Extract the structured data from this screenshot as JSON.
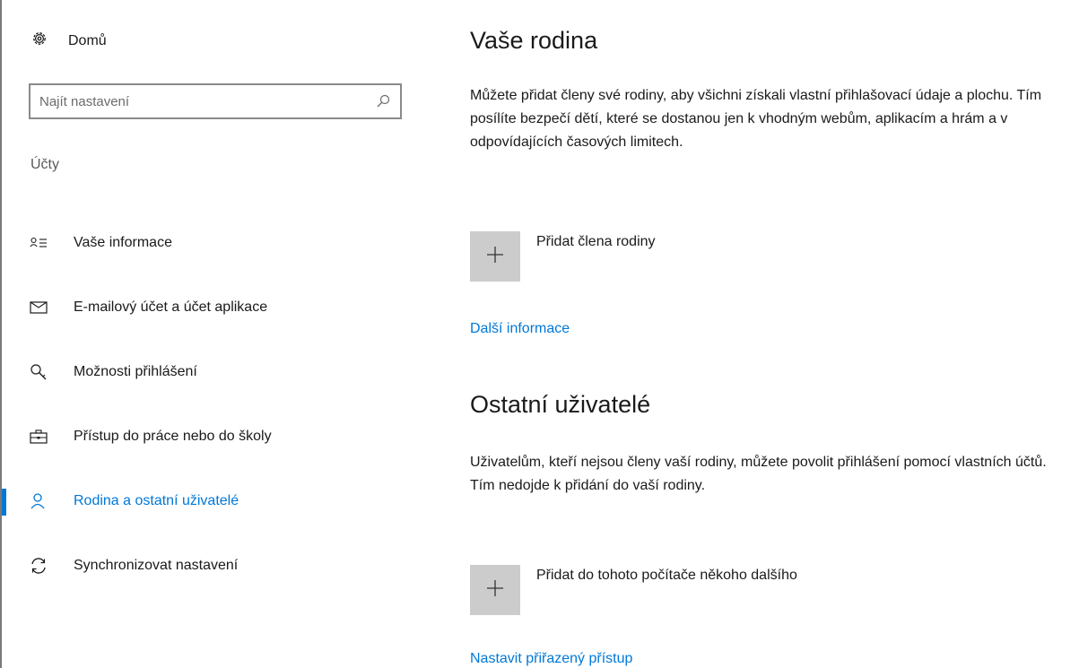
{
  "sidebar": {
    "home_label": "Domů",
    "search_placeholder": "Najít nastavení",
    "section_label": "Účty",
    "items": [
      {
        "label": "Vaše informace",
        "icon": "person-card-icon"
      },
      {
        "label": "E-mailový účet a účet aplikace",
        "icon": "mail-icon"
      },
      {
        "label": "Možnosti přihlášení",
        "icon": "key-icon"
      },
      {
        "label": "Přístup do práce nebo do školy",
        "icon": "briefcase-icon"
      },
      {
        "label": "Rodina a ostatní uživatelé",
        "icon": "person-icon",
        "active": true
      },
      {
        "label": "Synchronizovat nastavení",
        "icon": "sync-icon"
      }
    ]
  },
  "main": {
    "family": {
      "title": "Vaše rodina",
      "description": "Můžete přidat členy své rodiny, aby všichni získali vlastní přihlašovací údaje a plochu. Tím posílíte bezpečí dětí, které se dostanou jen k vhodným webům, aplikacím a hrám a v odpovídajících časových limitech.",
      "add_label": "Přidat člena rodiny",
      "link": "Další informace"
    },
    "others": {
      "title": "Ostatní uživatelé",
      "description": "Uživatelům, kteří nejsou členy vaší rodiny, můžete povolit přihlášení pomocí vlastních účtů. Tím nedojde k přidání do vaší rodiny.",
      "add_label": "Přidat do tohoto počítače někoho dalšího",
      "link": "Nastavit přiřazený přístup"
    }
  },
  "colors": {
    "accent": "#0078d7",
    "tile": "#cccccc"
  }
}
